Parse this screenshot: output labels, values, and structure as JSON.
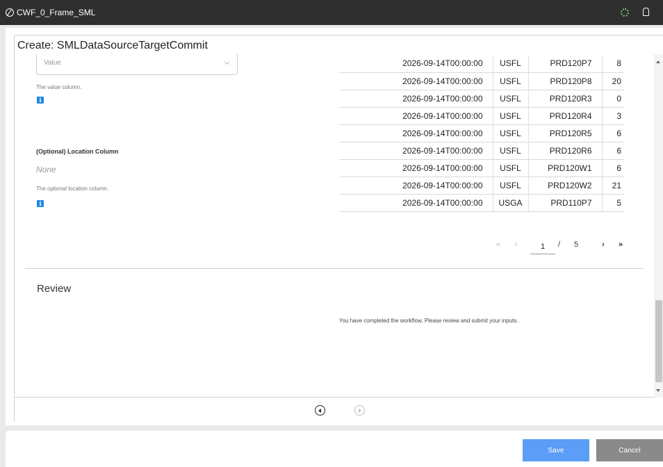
{
  "window": {
    "title": "CWF_0_Frame_SML"
  },
  "page": {
    "title": "Create: SMLDataSourceTargetCommit"
  },
  "value_field": {
    "selected": "Value",
    "help": "The value column."
  },
  "location_field": {
    "label": "(Optional) Location Column",
    "value": "None",
    "help": "The optional location column."
  },
  "table": {
    "rows": [
      {
        "date": "2026-09-14T00:00:00",
        "loc": "USFL",
        "product": "PRD120P7",
        "value": "8"
      },
      {
        "date": "2026-09-14T00:00:00",
        "loc": "USFL",
        "product": "PRD120P8",
        "value": "20"
      },
      {
        "date": "2026-09-14T00:00:00",
        "loc": "USFL",
        "product": "PRD120R3",
        "value": "0"
      },
      {
        "date": "2026-09-14T00:00:00",
        "loc": "USFL",
        "product": "PRD120R4",
        "value": "3"
      },
      {
        "date": "2026-09-14T00:00:00",
        "loc": "USFL",
        "product": "PRD120R5",
        "value": "6"
      },
      {
        "date": "2026-09-14T00:00:00",
        "loc": "USFL",
        "product": "PRD120R6",
        "value": "6"
      },
      {
        "date": "2026-09-14T00:00:00",
        "loc": "USFL",
        "product": "PRD120W1",
        "value": "6"
      },
      {
        "date": "2026-09-14T00:00:00",
        "loc": "USFL",
        "product": "PRD120W2",
        "value": "21"
      },
      {
        "date": "2026-09-14T00:00:00",
        "loc": "USGA",
        "product": "PRD110P7",
        "value": "5"
      }
    ]
  },
  "pagination": {
    "first": "«",
    "prev": "‹",
    "current": "1",
    "separator": "/",
    "total": "5",
    "next": "›",
    "last": "»"
  },
  "review": {
    "title": "Review",
    "message": "You have completed the workflow. Please review and submit your inputs."
  },
  "buttons": {
    "save": "Save",
    "cancel": "Cancel"
  },
  "icons": {
    "app": "app-logo-icon",
    "status": "spinner-icon",
    "notifications": "bell-icon",
    "info": "info-icon",
    "back": "back-arrow-icon",
    "forward": "forward-arrow-icon"
  },
  "colors": {
    "titlebar": "#2f2f2f",
    "save": "#5b9df7",
    "cancel": "#8a8a8a",
    "info": "#1e88e5",
    "status": "#6fc76f"
  }
}
